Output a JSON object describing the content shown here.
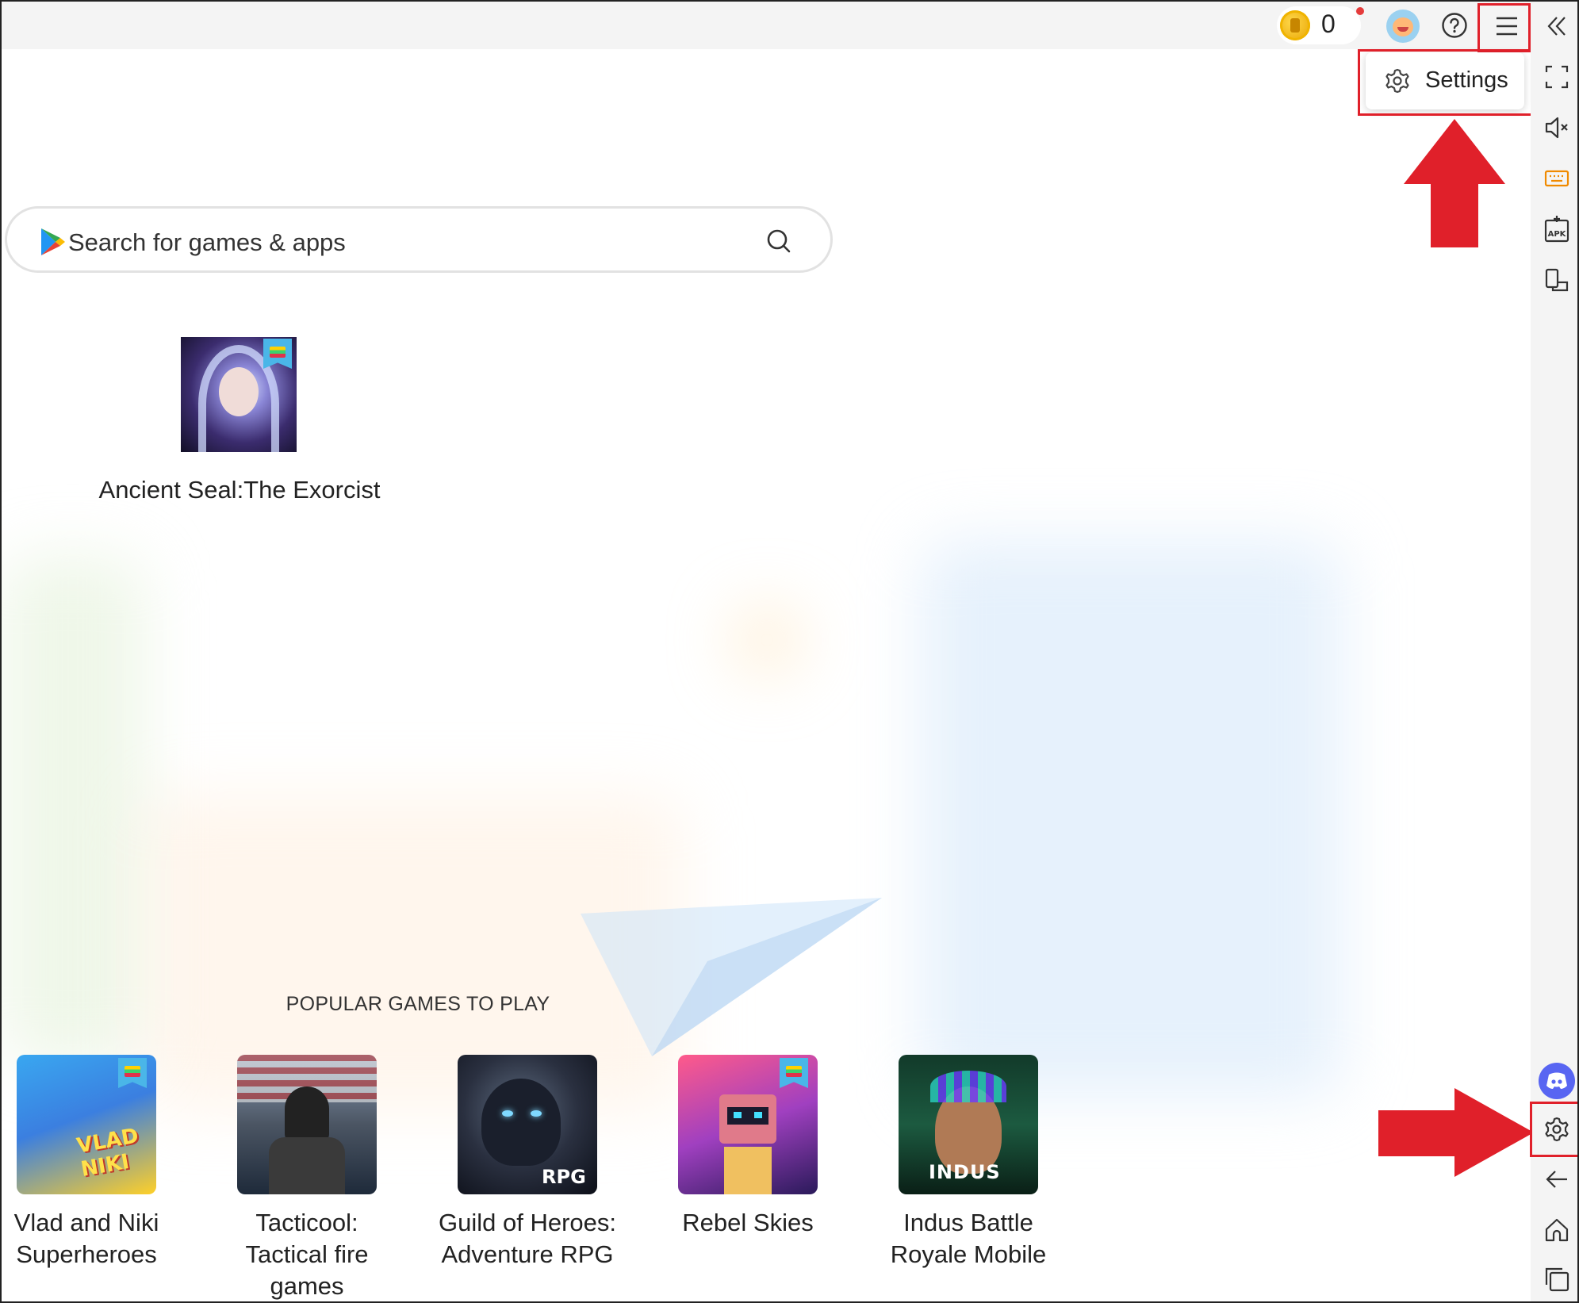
{
  "topbar": {
    "coin_count": "0",
    "coin_icon": "coin-icon",
    "avatar_icon": "avatar-icon",
    "help_icon": "help-icon",
    "menu_icon": "hamburger-menu-icon"
  },
  "dropdown": {
    "settings_label": "Settings",
    "settings_icon": "gear-icon"
  },
  "sidebar": {
    "icons": [
      "collapse-sidebar-icon",
      "fullscreen-icon",
      "volume-mute-icon",
      "keyboard-icon",
      "install-apk-icon",
      "multi-instance-icon",
      "discord-icon",
      "settings-gear-icon",
      "back-icon",
      "home-icon",
      "recent-apps-icon"
    ]
  },
  "search": {
    "placeholder": "Search for games & apps"
  },
  "featured": {
    "title": "Ancient Seal:The Exorcist"
  },
  "popular": {
    "header": "POPULAR GAMES TO PLAY",
    "games": [
      {
        "title": "Vlad and Niki Superheroes",
        "image_text": "VLAD NIKI"
      },
      {
        "title": "Tacticool: Tactical fire games",
        "image_text": ""
      },
      {
        "title": "Guild of Heroes: Adventure RPG",
        "image_text": "RPG"
      },
      {
        "title": "Rebel Skies",
        "image_text": ""
      },
      {
        "title": "Indus Battle Royale Mobile",
        "image_text": "INDUS"
      }
    ]
  },
  "colors": {
    "highlight": "#e0202a",
    "arrow": "#e0202a",
    "discord": "#5865f2",
    "topbar_bg": "#f4f4f4"
  }
}
